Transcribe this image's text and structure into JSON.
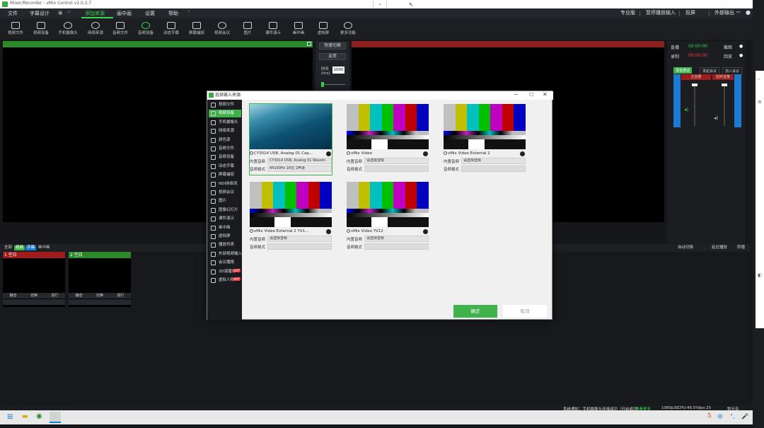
{
  "window": {
    "title": "Mixer/Recorder - vMix Control v2.0.2.7"
  },
  "menubar": {
    "items": [
      "文件",
      "字幕设计",
      "添加来源",
      "画中画",
      "设置",
      "帮助"
    ],
    "right": [
      "专业版",
      "暂停播放输入",
      "投屏",
      "外部输出"
    ]
  },
  "toolbar": {
    "tools": [
      "视频文件",
      "视频设备",
      "手机摄像头",
      "网络来源",
      "音频文件",
      "音频设备",
      "动态字幕",
      "屏幕捕捉",
      "视频会议",
      "图片",
      "课件演示",
      "画中画",
      "虚拟屏",
      "更多功能"
    ]
  },
  "center": {
    "quick_switch": "快速切换",
    "fade": "淡变",
    "time_label": "时长 (ms)",
    "time_value": "1000"
  },
  "right": {
    "live": "直播",
    "live_time": "00:00:00",
    "record": "录制",
    "record_time": "00:00:00",
    "screenshot": "截图",
    "playback": "回放",
    "tabs": [
      "语音通话",
      "发起会议",
      "加入会议"
    ],
    "ch1": "主音量",
    "ch2": "监听音量",
    "mic": "麦克风",
    "mic2": "耳机"
  },
  "bottom": {
    "tabs": [
      "全部",
      "视频",
      "字幕",
      "画中画"
    ],
    "right": [
      "自动切换",
      "延迟播放",
      "转播"
    ],
    "sources": [
      {
        "title": "1 空白"
      },
      {
        "title": "2 空白"
      }
    ],
    "src_btns": [
      "静音",
      "切换",
      "进行"
    ]
  },
  "status": {
    "text": "系统通知：手机摄像头连接成功（开启成功）",
    "link": "查看更多",
    "res": "1080p30",
    "cpu": "CPU:49.5%",
    "fps": "fps:25",
    "pause": "暂无音"
  },
  "dialog": {
    "title": "选择输入来源",
    "side": [
      {
        "label": "视频文件",
        "badge": ""
      },
      {
        "label": "视频设备",
        "badge": ""
      },
      {
        "label": "手机摄像头",
        "badge": ""
      },
      {
        "label": "网络来源",
        "badge": ""
      },
      {
        "label": "颜色源",
        "badge": ""
      },
      {
        "label": "音频文件",
        "badge": ""
      },
      {
        "label": "音频设备",
        "badge": ""
      },
      {
        "label": "动态字幕",
        "badge": ""
      },
      {
        "label": "屏幕捕捉",
        "badge": ""
      },
      {
        "label": "NDI网络流",
        "badge": ""
      },
      {
        "label": "视频会议",
        "badge": ""
      },
      {
        "label": "图片",
        "badge": ""
      },
      {
        "label": "图像幻灯片",
        "badge": ""
      },
      {
        "label": "课件演示",
        "badge": ""
      },
      {
        "label": "画中画",
        "badge": ""
      },
      {
        "label": "虚拟屏",
        "badge": ""
      },
      {
        "label": "播放列表",
        "badge": ""
      },
      {
        "label": "外部视频输入",
        "badge": ""
      },
      {
        "label": "会议播报",
        "badge": ""
      },
      {
        "label": "3D演播厅",
        "badge": "HOT"
      },
      {
        "label": "虚拟人物",
        "badge": "HOT"
      }
    ],
    "selected_index": 1,
    "key_audio": "内置音频",
    "key_format": "音频格式",
    "cards": [
      {
        "name": "CY3014 USB, Analog 01 Cap...",
        "audio": "CY3014 USB, Analog 01 WaveIn",
        "format": "44100Hz 16位 2声道",
        "thumb": "camera"
      },
      {
        "name": "vMix Video",
        "audio": "请选择音频",
        "format": "",
        "thumb": "bars"
      },
      {
        "name": "vMix Video External 2",
        "audio": "请选择音频",
        "format": "",
        "thumb": "bars"
      },
      {
        "name": "vMix Video External 2 YV1...",
        "audio": "请选择音频",
        "format": "",
        "thumb": "bars"
      },
      {
        "name": "vMix Video YV12",
        "audio": "请选择音频",
        "format": "",
        "thumb": "bars"
      }
    ],
    "ok": "确定",
    "cancel": "取消"
  }
}
